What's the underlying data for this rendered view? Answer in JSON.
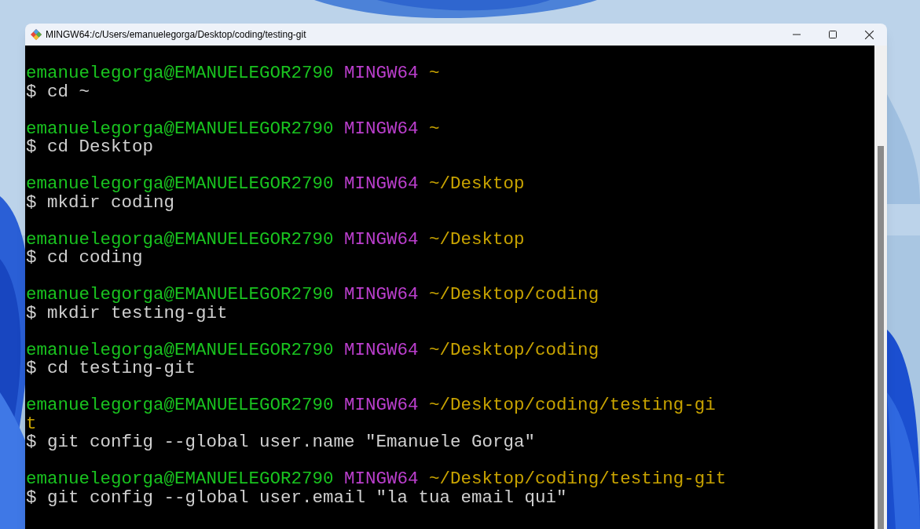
{
  "window": {
    "title": "MINGW64:/c/Users/emanuelegorga/Desktop/coding/testing-git"
  },
  "terminal": {
    "blocks": [
      {
        "user": "emanuelegorga@EMANUELEGOR2790",
        "host": "MINGW64",
        "path_lines": [
          "~"
        ],
        "command": "$ cd ~"
      },
      {
        "user": "emanuelegorga@EMANUELEGOR2790",
        "host": "MINGW64",
        "path_lines": [
          "~"
        ],
        "command": "$ cd Desktop"
      },
      {
        "user": "emanuelegorga@EMANUELEGOR2790",
        "host": "MINGW64",
        "path_lines": [
          "~/Desktop"
        ],
        "command": "$ mkdir coding"
      },
      {
        "user": "emanuelegorga@EMANUELEGOR2790",
        "host": "MINGW64",
        "path_lines": [
          "~/Desktop"
        ],
        "command": "$ cd coding"
      },
      {
        "user": "emanuelegorga@EMANUELEGOR2790",
        "host": "MINGW64",
        "path_lines": [
          "~/Desktop/coding"
        ],
        "command": "$ mkdir testing-git"
      },
      {
        "user": "emanuelegorga@EMANUELEGOR2790",
        "host": "MINGW64",
        "path_lines": [
          "~/Desktop/coding"
        ],
        "command": "$ cd testing-git"
      },
      {
        "user": "emanuelegorga@EMANUELEGOR2790",
        "host": "MINGW64",
        "path_lines": [
          "~/Desktop/coding/testing-gi",
          "t"
        ],
        "command": "$ git config --global user.name \"Emanuele Gorga\""
      },
      {
        "user": "emanuelegorga@EMANUELEGOR2790",
        "host": "MINGW64",
        "path_lines": [
          "~/Desktop/coding/testing-git"
        ],
        "command": "$ git config --global user.email \"la tua email qui\""
      }
    ]
  }
}
